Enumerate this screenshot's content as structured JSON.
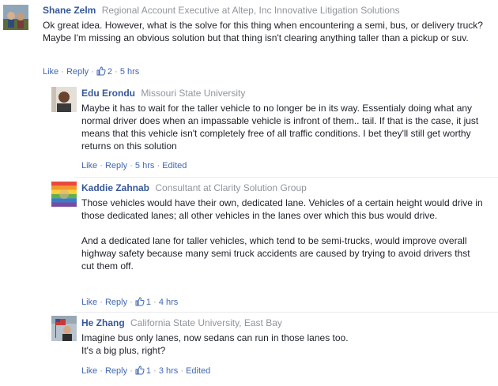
{
  "comments": [
    {
      "name": "Shane Zelm",
      "affiliation": "Regional Account Executive at Altep, Inc Innovative Litigation Solutions",
      "text": "Ok great idea. However, what is the solve for this thing when encountering a semi, bus, or delivery truck? Maybe I'm missing an obvious solution but that thing isn't clearing anything taller than a pickup or suv.",
      "like_label": "Like",
      "reply_label": "Reply",
      "likes": "2",
      "time": "5 hrs",
      "edited": ""
    },
    {
      "name": "Edu Erondu",
      "affiliation": "Missouri State University",
      "text": "Maybe it has to wait for the taller vehicle to no longer be in its way. Essentialy doing what any normal driver does when an impassable vehicle is infront of them.. tail. If that is the case, it just means that this vehicle isn't completely free of all traffic conditions. I bet they'll still get worthy returns on this solution",
      "like_label": "Like",
      "reply_label": "Reply",
      "likes": "",
      "time": "5 hrs",
      "edited": "Edited"
    },
    {
      "name": "Kaddie Zahnab",
      "affiliation": "Consultant at Clarity Solution Group",
      "text_p1": "Those vehicles would have their own, dedicated lane. Vehicles of a certain height would drive in those dedicated lanes; all other vehicles in the lanes over which this bus would drive.",
      "text_p2": "And a dedicated lane for taller vehicles, which tend to be semi-trucks, would improve overall highway safety because many semi truck accidents are caused by trying to avoid drivers thst cut them off.",
      "like_label": "Like",
      "reply_label": "Reply",
      "likes": "1",
      "time": "4 hrs",
      "edited": ""
    },
    {
      "name": "He Zhang",
      "affiliation": "California State University, East Bay",
      "text_l1": "Imagine bus only lanes, now sedans can run in those lanes too.",
      "text_l2": "It's a big plus, right?",
      "like_label": "Like",
      "reply_label": "Reply",
      "likes": "1",
      "time": "3 hrs",
      "edited": "Edited"
    }
  ],
  "colors": {
    "name_link": "#365899",
    "action_link": "#4267b2",
    "meta_gray": "#90949c",
    "body_text": "#1d2129"
  }
}
